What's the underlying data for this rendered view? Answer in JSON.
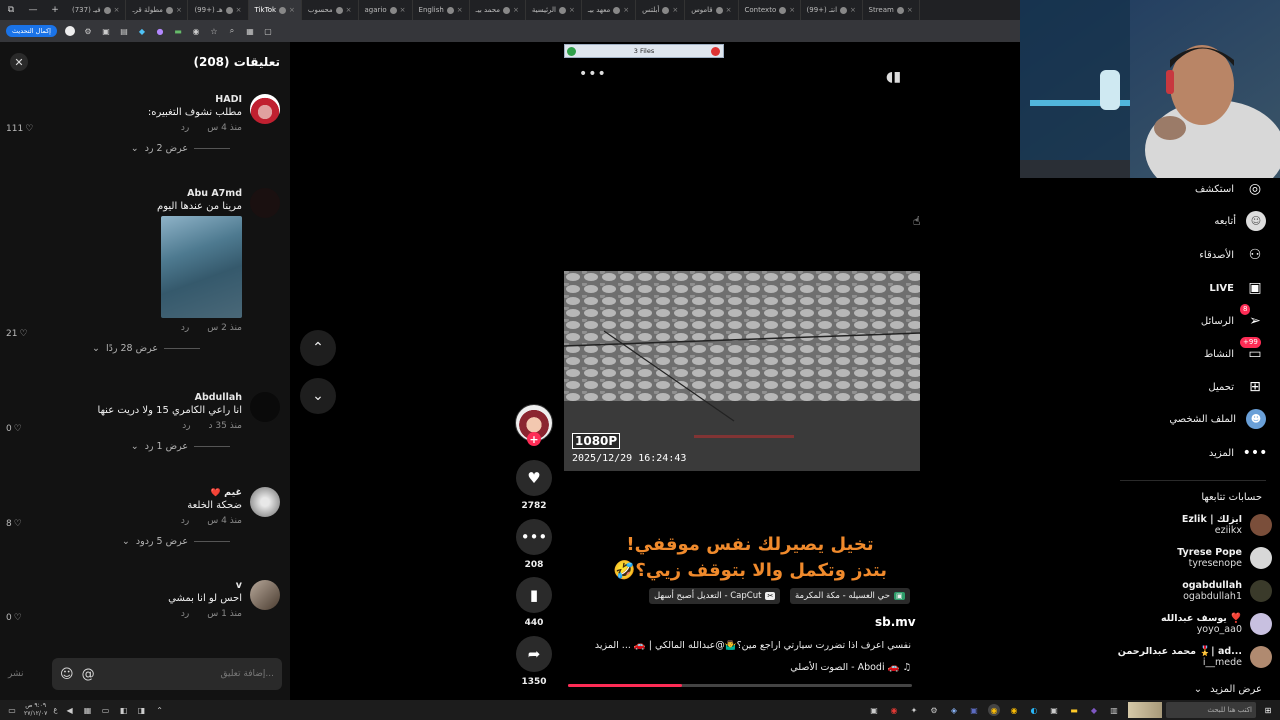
{
  "browser": {
    "window_controls": [
      "⧉",
      "—"
    ],
    "tabs": [
      {
        "label": "Stream",
        "active": false
      },
      {
        "label": "(99+) انتـ",
        "active": false
      },
      {
        "label": "Contexto",
        "active": false
      },
      {
        "label": "قاموس",
        "active": false
      },
      {
        "label": "أبلتس",
        "active": false
      },
      {
        "label": "معهد بيـ",
        "active": false
      },
      {
        "label": "الرئيسية",
        "active": false
      },
      {
        "label": "محمد بيـ",
        "active": false
      },
      {
        "label": "English",
        "active": false
      },
      {
        "label": "agario",
        "active": false
      },
      {
        "label": "محسوب",
        "active": false
      },
      {
        "label": "TikTok",
        "active": true
      },
      {
        "label": "(99+) هـ",
        "active": false
      },
      {
        "label": "مطولة قرـ",
        "active": false
      },
      {
        "label": "(737) فيـ",
        "active": false
      }
    ],
    "new_tab": "+",
    "relaunch_label": "إكمال التحديث"
  },
  "comments": {
    "title": "تعليقات (208)",
    "close": "✕",
    "items": [
      {
        "user": "HADI",
        "text": "مطلب نشوف التغبيره:",
        "time": "منذ 4 س",
        "reply": "رد",
        "likes": "111",
        "replies_label": "عرض 2 رد"
      },
      {
        "user": "Abu A7md",
        "text": "مرينا من عندها اليوم",
        "time": "منذ 2 س",
        "reply": "رد",
        "likes": "21",
        "replies_label": "عرض 28 ردًا"
      },
      {
        "user": "Abdullah",
        "text": "انا راعي الكامري 15 ولا دريت عنها",
        "time": "منذ 35 د",
        "reply": "رد",
        "likes": "0",
        "replies_label": "عرض 1 رد"
      },
      {
        "user": "غيم",
        "user_badge": "❤️",
        "text": "ضحكة الخلعة",
        "time": "منذ 4 س",
        "reply": "رد",
        "likes": "8",
        "replies_label": "عرض 5 ردود"
      },
      {
        "user": "v",
        "text": "احس لو انا بمشي",
        "time": "منذ 1 س",
        "reply": "رد",
        "likes": "0"
      }
    ],
    "input_placeholder": "إضافة تعليق...",
    "post_label": "نشر",
    "at_icon": "@",
    "emoji_icon": "☺"
  },
  "video": {
    "files_bar": "3 Files",
    "resolution": "1080P",
    "timestamp": "2025/12/29 16:24:43",
    "caption_line1": "تخيل يصيرلك نفس موقفي!",
    "caption_line2": "بتدز وتكمل والا بتوقف زيي؟🤣",
    "chip_location": "حي العسيله - مكة المكرمة",
    "chip_capcut": "CapCut - التعديل أصبح أسهل",
    "author": "sb.mv",
    "description": "نفسي اعرف اذا تضررت سيارتي اراجع مين؟🤷‍♂️@عبدالله المالكي | 🚗 ... المزيد",
    "sound": "♫ 🚗 Abodi - الصوت الأصلي",
    "progress_fraction": 0.33,
    "likes": "2782",
    "comments_count": "208",
    "saves": "440",
    "shares": "1350"
  },
  "nav": {
    "items": [
      {
        "label": "استكشف",
        "icon": "compass-icon"
      },
      {
        "label": "أتابعه",
        "icon": "following-icon"
      },
      {
        "label": "الأصدقاء",
        "icon": "friends-icon"
      },
      {
        "label": "LIVE",
        "icon": "live-icon"
      },
      {
        "label": "الرسائل",
        "icon": "messages-icon",
        "badge": "8"
      },
      {
        "label": "النشاط",
        "icon": "activity-icon",
        "badge": "99+"
      },
      {
        "label": "تحميل",
        "icon": "upload-icon"
      },
      {
        "label": "الملف الشخصي",
        "icon": "profile-icon"
      },
      {
        "label": "المزيد",
        "icon": "more-icon"
      }
    ],
    "following_title": "حسابات تتابعها",
    "accounts": [
      {
        "name": "Ezlik | ايزلك",
        "handle": "eziikx",
        "color": "#7a4e3a"
      },
      {
        "name": "Tyrese Pope",
        "handle": "tyresenope",
        "color": "#d8d8d8"
      },
      {
        "name": "ogabdullah",
        "handle": "ogabdullah1",
        "color": "#3a3a2a"
      },
      {
        "name": "يوسف عبدالله ❣️",
        "handle": "yoyo_aa0",
        "color": "#c8c0e0"
      },
      {
        "name": "محمد عبدالرحمن 🎖️| ad...",
        "handle": "i__mede",
        "color": "#b08a70"
      }
    ],
    "see_more": "عرض المزيد"
  },
  "taskbar": {
    "clock_time": "٩:٠٩ ص",
    "clock_date": "٢٧/١٢/٠٧",
    "lang": "ع",
    "search_placeholder": "اكتب هنا للبحث"
  }
}
